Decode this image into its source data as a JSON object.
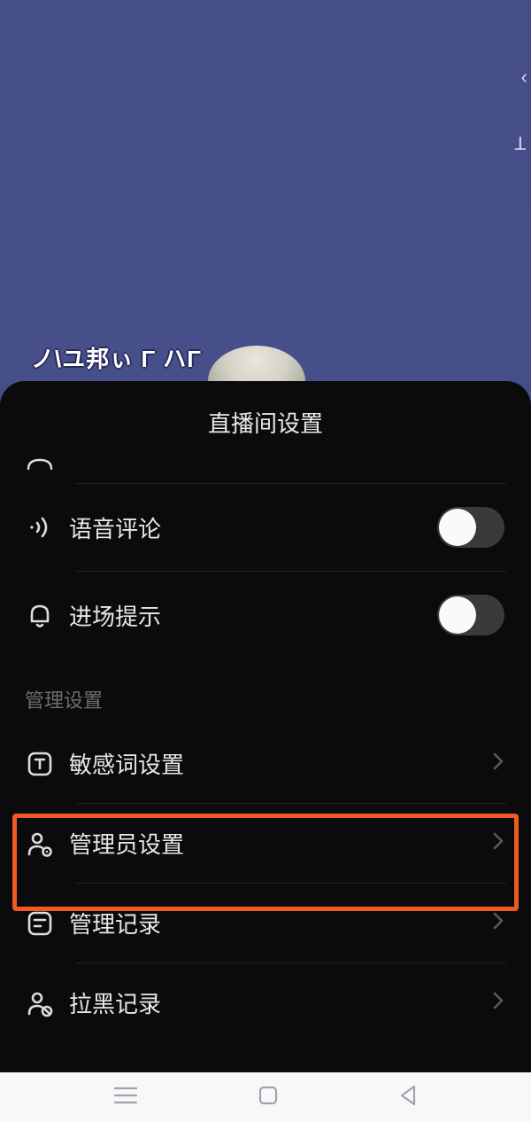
{
  "backdrop": {
    "scribble": "ノ\\ユ邦ぃ   Γ  ハΓ",
    "edge1": "‹",
    "edge2": "ꓕ"
  },
  "sheet": {
    "title": "直播间设置"
  },
  "toggles": {
    "voice_comment": {
      "label": "语音评论"
    },
    "entry_notice": {
      "label": "进场提示"
    }
  },
  "section": {
    "management": "管理设置"
  },
  "items": {
    "sensitive": {
      "label": "敏感词设置"
    },
    "admin": {
      "label": "管理员设置"
    },
    "manage_log": {
      "label": "管理记录"
    },
    "block_log": {
      "label": "拉黑记录"
    }
  }
}
